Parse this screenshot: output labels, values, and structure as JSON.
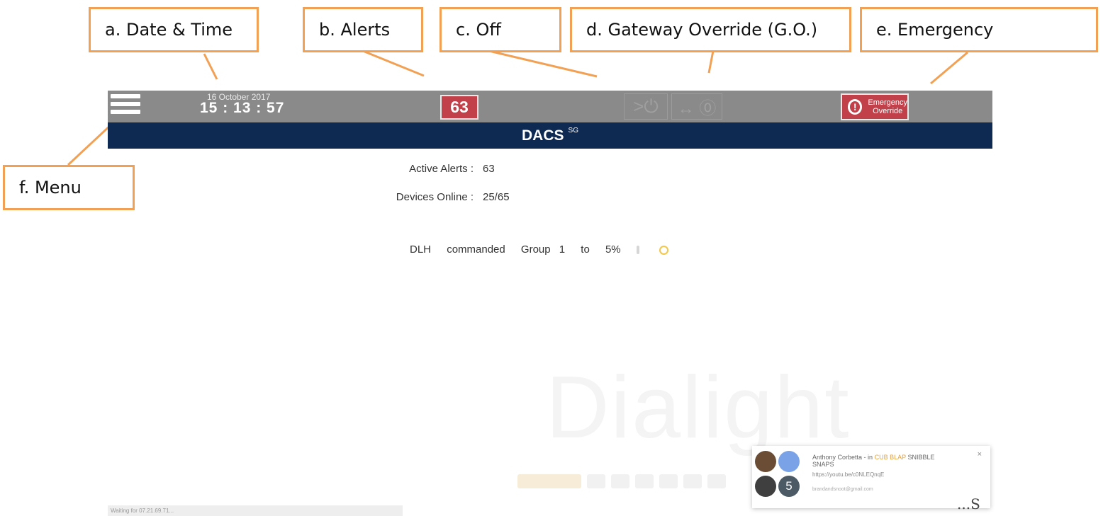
{
  "callouts": {
    "date_time": "a. Date & Time",
    "alerts": "b. Alerts",
    "off": "c. Off",
    "gateway_override": "d. Gateway Override (G.O.)",
    "emergency": "e. Emergency",
    "menu": "f. Menu"
  },
  "header": {
    "date": "16 October 2017",
    "time": "15 : 13 : 57",
    "alerts_count": "63",
    "off_label": ">⏻",
    "go_label": "↔ ⓪",
    "emergency_icon": "!",
    "emergency_line1": "Emergency",
    "emergency_line2": "Override"
  },
  "title": {
    "name": "DACS",
    "suffix": "SG"
  },
  "stats": {
    "active_alerts_label": "Active Alerts :",
    "active_alerts_value": "63",
    "devices_online_label": "Devices Online :",
    "devices_online_value": "25/65"
  },
  "command": {
    "user": "DLH",
    "verb": "commanded",
    "group": "Group 1",
    "to": "to",
    "level": "5%"
  },
  "watermark": "Dialight",
  "status_bar": "Waiting for 07.21.69.71...",
  "notification": {
    "line1_prefix": "Anthony Corbetta - in",
    "line1_highlight": "CUB BLAP",
    "line1_suffix": "SNIBBLE SNAPS",
    "line2": "https://youtu.be/c0NLEQnqE",
    "line3": "brandandsnoot@gmail.com",
    "badge_count": "5",
    "close": "×"
  },
  "corner_text": "...S",
  "colors": {
    "callout_border": "#f2a154",
    "topbar": "#8a8a8a",
    "titlebar": "#0f2a52",
    "alert_red": "#c1404a"
  }
}
